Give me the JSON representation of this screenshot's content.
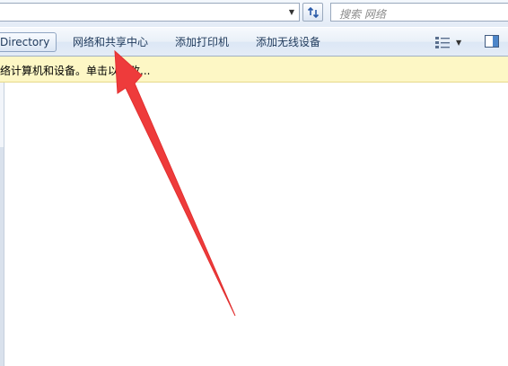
{
  "address_bar": {
    "dropdown_icon": "chevron-down-icon",
    "refresh_icon": "refresh-arrows-icon"
  },
  "search": {
    "placeholder": "搜索 网络",
    "icon": "search-icon"
  },
  "command_bar": {
    "items": [
      {
        "label": "Directory"
      },
      {
        "label": "网络和共享中心"
      },
      {
        "label": "添加打印机"
      },
      {
        "label": "添加无线设备"
      }
    ],
    "views_icon": "view-options-icon",
    "preview_icon": "preview-pane-icon"
  },
  "info_bar": {
    "text": "络计算机和设备。单击以更改..."
  },
  "annotation": {
    "color": "#ee3b3b",
    "points_to": "网络和共享中心"
  }
}
